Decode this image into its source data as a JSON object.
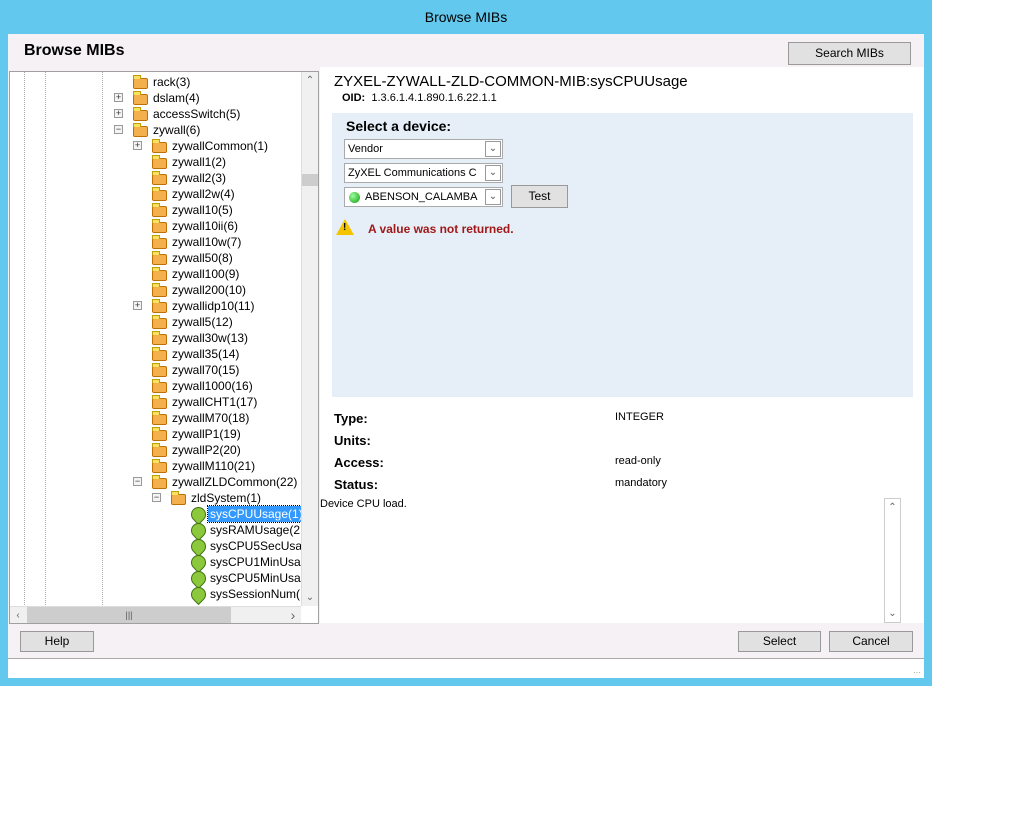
{
  "window": {
    "title": "Browse MIBs"
  },
  "header": {
    "title": "Browse MIBs",
    "search_button": "Search MIBs"
  },
  "tree": {
    "items": [
      {
        "label": "rack(3)",
        "level": 0,
        "expander": null,
        "type": "folder"
      },
      {
        "label": "dslam(4)",
        "level": 0,
        "expander": "+",
        "type": "folder"
      },
      {
        "label": "accessSwitch(5)",
        "level": 0,
        "expander": "+",
        "type": "folder"
      },
      {
        "label": "zywall(6)",
        "level": 0,
        "expander": "-",
        "type": "folder"
      },
      {
        "label": "zywallCommon(1)",
        "level": 1,
        "expander": "+",
        "type": "folder"
      },
      {
        "label": "zywall1(2)",
        "level": 1,
        "expander": null,
        "type": "folder"
      },
      {
        "label": "zywall2(3)",
        "level": 1,
        "expander": null,
        "type": "folder"
      },
      {
        "label": "zywall2w(4)",
        "level": 1,
        "expander": null,
        "type": "folder"
      },
      {
        "label": "zywall10(5)",
        "level": 1,
        "expander": null,
        "type": "folder"
      },
      {
        "label": "zywall10ii(6)",
        "level": 1,
        "expander": null,
        "type": "folder"
      },
      {
        "label": "zywall10w(7)",
        "level": 1,
        "expander": null,
        "type": "folder"
      },
      {
        "label": "zywall50(8)",
        "level": 1,
        "expander": null,
        "type": "folder"
      },
      {
        "label": "zywall100(9)",
        "level": 1,
        "expander": null,
        "type": "folder"
      },
      {
        "label": "zywall200(10)",
        "level": 1,
        "expander": null,
        "type": "folder"
      },
      {
        "label": "zywallidp10(11)",
        "level": 1,
        "expander": "+",
        "type": "folder"
      },
      {
        "label": "zywall5(12)",
        "level": 1,
        "expander": null,
        "type": "folder"
      },
      {
        "label": "zywall30w(13)",
        "level": 1,
        "expander": null,
        "type": "folder"
      },
      {
        "label": "zywall35(14)",
        "level": 1,
        "expander": null,
        "type": "folder"
      },
      {
        "label": "zywall70(15)",
        "level": 1,
        "expander": null,
        "type": "folder"
      },
      {
        "label": "zywall1000(16)",
        "level": 1,
        "expander": null,
        "type": "folder"
      },
      {
        "label": "zywallCHT1(17)",
        "level": 1,
        "expander": null,
        "type": "folder"
      },
      {
        "label": "zywallM70(18)",
        "level": 1,
        "expander": null,
        "type": "folder"
      },
      {
        "label": "zywallP1(19)",
        "level": 1,
        "expander": null,
        "type": "folder"
      },
      {
        "label": "zywallP2(20)",
        "level": 1,
        "expander": null,
        "type": "folder"
      },
      {
        "label": "zywallM110(21)",
        "level": 1,
        "expander": null,
        "type": "folder"
      },
      {
        "label": "zywallZLDCommon(22)",
        "level": 1,
        "expander": "-",
        "type": "folder"
      },
      {
        "label": "zldSystem(1)",
        "level": 2,
        "expander": "-",
        "type": "folder"
      },
      {
        "label": "sysCPUUsage(1)",
        "level": 3,
        "expander": null,
        "type": "leaf",
        "selected": true
      },
      {
        "label": "sysRAMUsage(2",
        "level": 3,
        "expander": null,
        "type": "leaf"
      },
      {
        "label": "sysCPU5SecUsa",
        "level": 3,
        "expander": null,
        "type": "leaf"
      },
      {
        "label": "sysCPU1MinUsa",
        "level": 3,
        "expander": null,
        "type": "leaf"
      },
      {
        "label": "sysCPU5MinUsa",
        "level": 3,
        "expander": null,
        "type": "leaf"
      },
      {
        "label": "sysSessionNum(",
        "level": 3,
        "expander": null,
        "type": "leaf"
      }
    ]
  },
  "detail": {
    "title": "ZYXEL-ZYWALL-ZLD-COMMON-MIB:sysCPUUsage",
    "oid_label": "OID:",
    "oid": "1.3.6.1.4.1.890.1.6.22.1.1",
    "select_device_label": "Select a device:",
    "filter_type": "Vendor",
    "vendor": "ZyXEL Communications C",
    "device": "ABENSON_CALAMBA",
    "test_button": "Test",
    "warning": "A value was not returned.",
    "type_label": "Type:",
    "type_value": "INTEGER",
    "units_label": "Units:",
    "access_label": "Access:",
    "access_value": "read-only",
    "status_label": "Status:",
    "status_value": "mandatory",
    "description": "Device CPU load."
  },
  "footer": {
    "help": "Help",
    "select": "Select",
    "cancel": "Cancel"
  }
}
